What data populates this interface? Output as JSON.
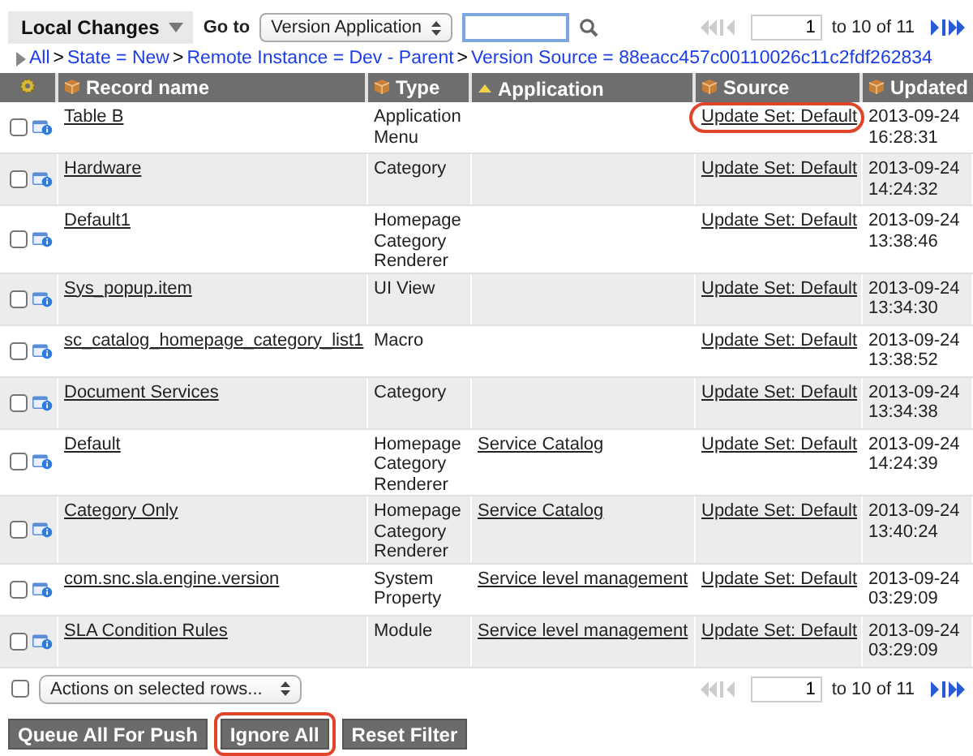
{
  "list_title": "Local Changes",
  "goto": {
    "label": "Go to",
    "select": "Version Application"
  },
  "pagination_top": {
    "page": "1",
    "range": "to 10 of 11",
    "prev_enabled": false,
    "next_enabled": true
  },
  "breadcrumb": {
    "separator": ">",
    "items": [
      "All",
      "State = New",
      "Remote Instance = Dev - Parent",
      "Version Source = 88eacc457c00110026c11c2fdf262834"
    ]
  },
  "columns": [
    {
      "label": "Record name",
      "sorted": false
    },
    {
      "label": "Type",
      "sorted": false
    },
    {
      "label": "Application",
      "sorted": true
    },
    {
      "label": "Source",
      "sorted": false
    },
    {
      "label": "Updated",
      "sorted": false
    }
  ],
  "rows": [
    {
      "checked": false,
      "name": "Table B",
      "type": "Application Menu",
      "application": "",
      "source": "Update Set: Default",
      "source_highlighted": true,
      "updated": "2013-09-24 16:28:31"
    },
    {
      "checked": false,
      "name": "Hardware",
      "type": "Category",
      "application": "",
      "source": "Update Set: Default",
      "source_highlighted": false,
      "updated": "2013-09-24 14:24:32"
    },
    {
      "checked": false,
      "name": "Default1",
      "type": "Homepage Category Renderer",
      "application": "",
      "source": "Update Set: Default",
      "source_highlighted": false,
      "updated": "2013-09-24 13:38:46"
    },
    {
      "checked": false,
      "name": "Sys_popup.item",
      "type": "UI View",
      "application": "",
      "source": "Update Set: Default",
      "source_highlighted": false,
      "updated": "2013-09-24 13:34:30"
    },
    {
      "checked": false,
      "name": "sc_catalog_homepage_category_list1",
      "type": "Macro",
      "application": "",
      "source": "Update Set: Default",
      "source_highlighted": false,
      "updated": "2013-09-24 13:38:52"
    },
    {
      "checked": false,
      "name": "Document Services",
      "type": "Category",
      "application": "",
      "source": "Update Set: Default",
      "source_highlighted": false,
      "updated": "2013-09-24 13:34:38"
    },
    {
      "checked": false,
      "name": "Default",
      "type": "Homepage Category Renderer",
      "application": "Service Catalog",
      "source": "Update Set: Default",
      "source_highlighted": false,
      "updated": "2013-09-24 14:24:39"
    },
    {
      "checked": false,
      "name": "Category Only",
      "type": "Homepage Category Renderer",
      "application": "Service Catalog",
      "source": "Update Set: Default",
      "source_highlighted": false,
      "updated": "2013-09-24 13:40:24"
    },
    {
      "checked": false,
      "name": "com.snc.sla.engine.version",
      "type": "System Property",
      "application": "Service level management",
      "source": "Update Set: Default",
      "source_highlighted": false,
      "updated": "2013-09-24 03:29:09"
    },
    {
      "checked": false,
      "name": "SLA Condition Rules",
      "type": "Module",
      "application": "Service level management",
      "source": "Update Set: Default",
      "source_highlighted": false,
      "updated": "2013-09-24 03:29:09"
    }
  ],
  "select_all_checked": false,
  "actions_select": "Actions on selected rows...",
  "pagination_bottom": {
    "page": "1",
    "range": "to 10 of 11",
    "prev_enabled": false,
    "next_enabled": true
  },
  "buttons": [
    {
      "label": "Queue All For Push",
      "highlighted": false
    },
    {
      "label": "Ignore All",
      "highlighted": true
    },
    {
      "label": "Reset Filter",
      "highlighted": false
    }
  ]
}
